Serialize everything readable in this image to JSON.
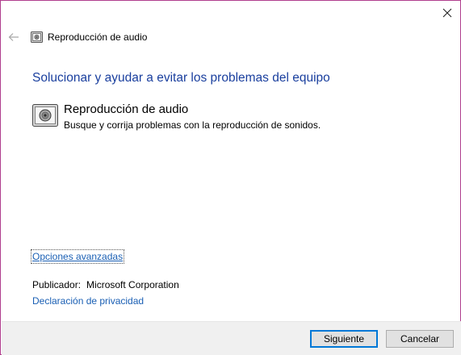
{
  "window": {
    "close_icon": "close-icon"
  },
  "nav": {
    "back_icon": "back-arrow-icon",
    "header_icon": "audio-troubleshooter-icon",
    "title": "Reproducción de audio"
  },
  "main": {
    "heading": "Solucionar y ayudar a evitar los problemas del equipo",
    "item": {
      "icon": "audio-troubleshooter-icon",
      "title": "Reproducción de audio",
      "description": "Busque y corrija problemas con la reproducción de sonidos."
    },
    "advanced_link": "Opciones avanzadas",
    "publisher_label": "Publicador:",
    "publisher_value": "Microsoft Corporation",
    "privacy_link": "Declaración de privacidad"
  },
  "footer": {
    "next_label": "Siguiente",
    "cancel_label": "Cancelar"
  },
  "colors": {
    "accent_border": "#b03f8e",
    "heading": "#1a3f9e",
    "link": "#1a5fb4",
    "footer_bg": "#f0f0f0",
    "default_button_border": "#0078d7"
  }
}
